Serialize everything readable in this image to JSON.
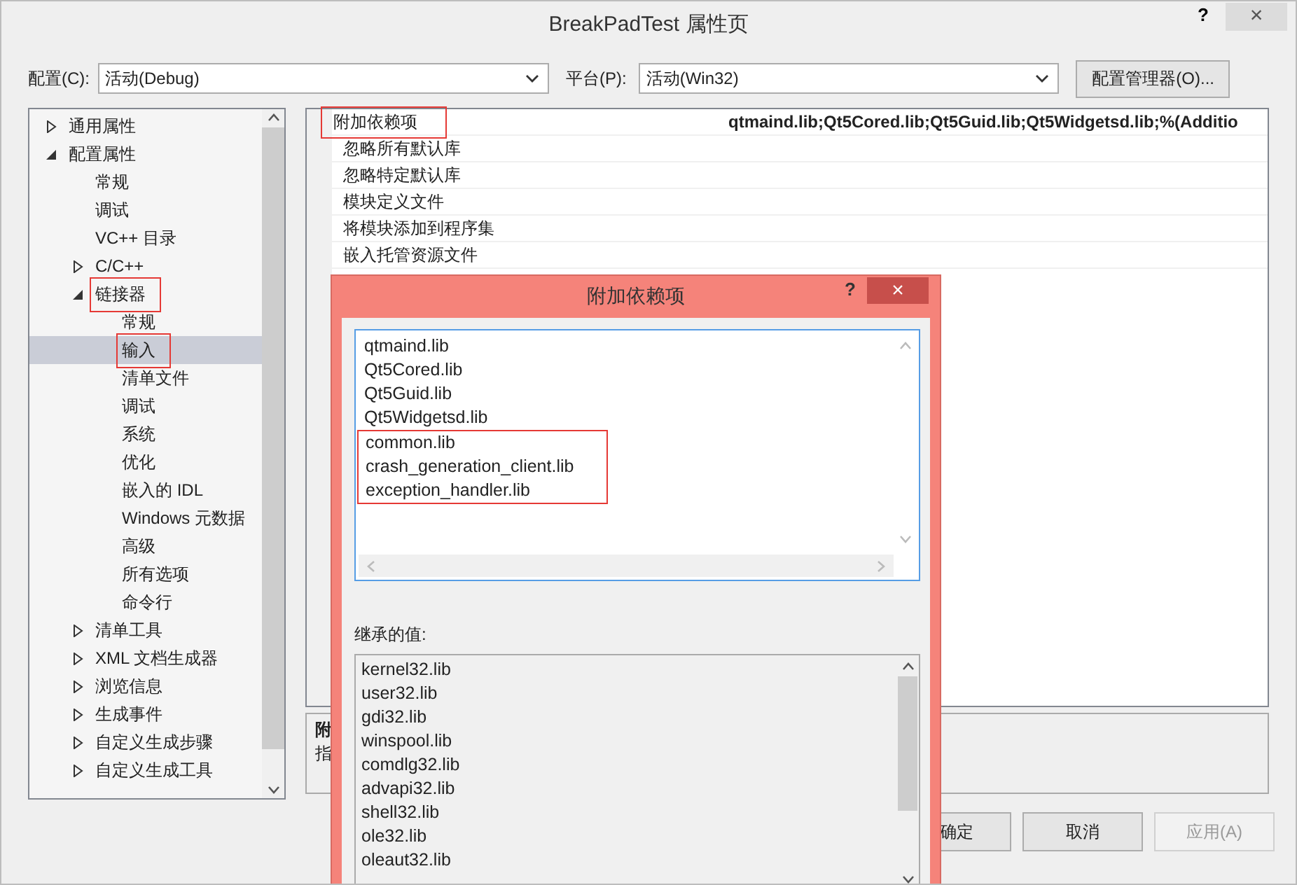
{
  "window": {
    "title": "BreakPadTest 属性页",
    "help": "?",
    "close": "×"
  },
  "toolbar": {
    "config_label": "配置(C):",
    "config_value": "活动(Debug)",
    "platform_label": "平台(P):",
    "platform_value": "活动(Win32)",
    "manager_button": "配置管理器(O)..."
  },
  "tree": [
    {
      "label": "通用属性",
      "expanded": false,
      "selected": false,
      "boxed": false
    },
    {
      "label": "配置属性",
      "expanded": true,
      "selected": false,
      "boxed": false,
      "children": [
        {
          "label": "常规",
          "selected": false,
          "boxed": false
        },
        {
          "label": "调试",
          "selected": false,
          "boxed": false
        },
        {
          "label": "VC++ 目录",
          "selected": false,
          "boxed": false
        },
        {
          "label": "C/C++",
          "expanded": false,
          "selected": false,
          "boxed": false
        },
        {
          "label": "链接器",
          "expanded": true,
          "selected": false,
          "boxed": true,
          "children": [
            {
              "label": "常规",
              "selected": false,
              "boxed": false
            },
            {
              "label": "输入",
              "selected": true,
              "boxed": true
            },
            {
              "label": "清单文件",
              "selected": false,
              "boxed": false
            },
            {
              "label": "调试",
              "selected": false,
              "boxed": false
            },
            {
              "label": "系统",
              "selected": false,
              "boxed": false
            },
            {
              "label": "优化",
              "selected": false,
              "boxed": false
            },
            {
              "label": "嵌入的 IDL",
              "selected": false,
              "boxed": false
            },
            {
              "label": "Windows 元数据",
              "selected": false,
              "boxed": false
            },
            {
              "label": "高级",
              "selected": false,
              "boxed": false
            },
            {
              "label": "所有选项",
              "selected": false,
              "boxed": false
            },
            {
              "label": "命令行",
              "selected": false,
              "boxed": false
            }
          ]
        },
        {
          "label": "清单工具",
          "expanded": false,
          "selected": false,
          "boxed": false
        },
        {
          "label": "XML 文档生成器",
          "expanded": false,
          "selected": false,
          "boxed": false
        },
        {
          "label": "浏览信息",
          "expanded": false,
          "selected": false,
          "boxed": false
        },
        {
          "label": "生成事件",
          "expanded": false,
          "selected": false,
          "boxed": false
        },
        {
          "label": "自定义生成步骤",
          "expanded": false,
          "selected": false,
          "boxed": false
        },
        {
          "label": "自定义生成工具",
          "expanded": false,
          "selected": false,
          "boxed": false
        }
      ]
    }
  ],
  "properties": [
    {
      "name": "附加依赖项",
      "value": "qtmaind.lib;Qt5Cored.lib;Qt5Guid.lib;Qt5Widgetsd.lib;%(Additio",
      "boxed": true
    },
    {
      "name": "忽略所有默认库",
      "boxed": false
    },
    {
      "name": "忽略特定默认库",
      "boxed": false
    },
    {
      "name": "模块定义文件",
      "boxed": false
    },
    {
      "name": "将模块添加到程序集",
      "boxed": false
    },
    {
      "name": "嵌入托管资源文件",
      "boxed": false
    }
  ],
  "description": {
    "title": "附",
    "text": "指"
  },
  "buttons": [
    {
      "label": "确定",
      "disabled": false
    },
    {
      "label": "取消",
      "disabled": false
    },
    {
      "label": "应用(A)",
      "disabled": true
    }
  ],
  "dialog": {
    "title": "附加依赖项",
    "help": "?",
    "close": "×",
    "values": [
      {
        "text": "qtmaind.lib",
        "boxed": false
      },
      {
        "text": "Qt5Cored.lib",
        "boxed": false
      },
      {
        "text": "Qt5Guid.lib",
        "boxed": false
      },
      {
        "text": "Qt5Widgetsd.lib",
        "boxed": false
      },
      {
        "text": "common.lib",
        "boxed": true
      },
      {
        "text": "crash_generation_client.lib",
        "boxed": true
      },
      {
        "text": "exception_handler.lib",
        "boxed": true
      }
    ],
    "inherited_label": "继承的值:",
    "inherited": [
      "kernel32.lib",
      "user32.lib",
      "gdi32.lib",
      "winspool.lib",
      "comdlg32.lib",
      "advapi32.lib",
      "shell32.lib",
      "ole32.lib",
      "oleaut32.lib"
    ]
  }
}
